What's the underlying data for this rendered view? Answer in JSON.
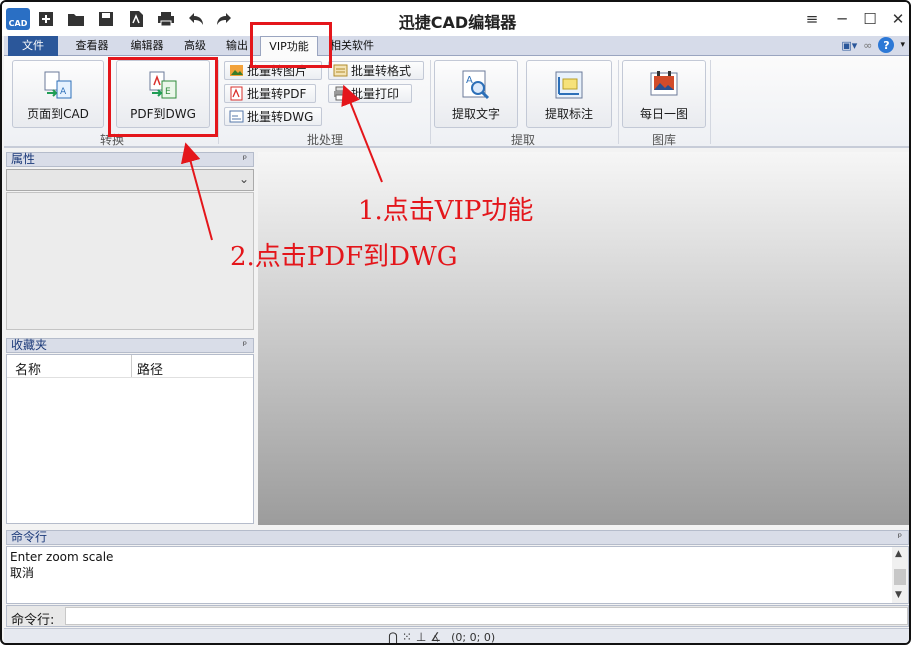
{
  "window": {
    "logo_text": "CAD",
    "title": "迅捷CAD编辑器",
    "controls": {
      "menu": "≡",
      "minimize": "─",
      "maximize": "☐",
      "close": "✕"
    }
  },
  "quick_access": [
    "new-icon",
    "open-icon",
    "save-icon",
    "pdf-icon",
    "print-icon",
    "undo-icon",
    "redo-icon"
  ],
  "tabs": [
    {
      "label": "文件"
    },
    {
      "label": "查看器"
    },
    {
      "label": "编辑器"
    },
    {
      "label": "高级"
    },
    {
      "label": "输出"
    },
    {
      "label": "VIP功能"
    },
    {
      "label": "相关软件"
    }
  ],
  "active_tab": "VIP功能",
  "ribbon": {
    "convert": {
      "label": "转换",
      "page_to_cad": "页面到CAD",
      "pdf_to_dwg": "PDF到DWG"
    },
    "batch": {
      "label": "批处理",
      "to_image": "批量转图片",
      "to_pdf": "批量转PDF",
      "to_dwg": "批量转DWG",
      "to_format": "批量转格式",
      "print": "批量打印"
    },
    "extract": {
      "label": "提取",
      "text": "提取文字",
      "annotation": "提取标注"
    },
    "gallery": {
      "label": "图库",
      "daily": "每日一图"
    }
  },
  "help": {
    "label": "?"
  },
  "panels": {
    "properties": {
      "title": "属性",
      "pin": "ᵖ"
    },
    "favorites": {
      "title": "收藏夹",
      "pin": "ᵖ",
      "columns": [
        "名称",
        "路径"
      ]
    }
  },
  "annotations": {
    "step1": "1.点击VIP功能",
    "step2": "2.点击PDF到DWG"
  },
  "command": {
    "title": "命令行",
    "log": [
      "Enter zoom scale",
      "取消"
    ],
    "input_label": "命令行:",
    "input_value": ""
  },
  "status": {
    "coords": "(0; 0; 0)"
  },
  "colors": {
    "accent": "#2b579a",
    "annotation": "#e4161b"
  }
}
